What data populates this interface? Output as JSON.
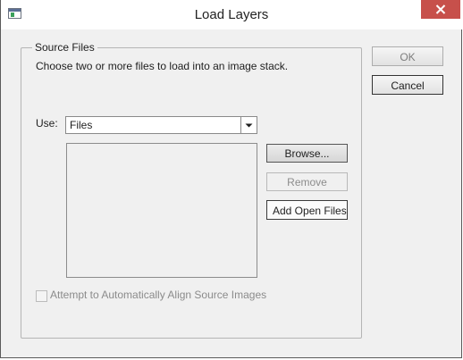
{
  "window": {
    "title": "Load Layers",
    "close_icon": "close-icon",
    "app_icon": "dialog-window-icon"
  },
  "group": {
    "legend": "Source Files",
    "description": "Choose two or more files to load into an image stack."
  },
  "use": {
    "label": "Use:",
    "selected": "Files",
    "dropdown_icon": "chevron-down-icon"
  },
  "file_list": {
    "items": []
  },
  "buttons": {
    "ok": "OK",
    "cancel": "Cancel",
    "browse": "Browse...",
    "remove": "Remove",
    "add_open_files": "Add Open Files"
  },
  "options": {
    "auto_align_label": "Attempt to Automatically Align Source Images",
    "auto_align_checked": false
  },
  "colors": {
    "close_button": "#c7504b",
    "dialog_background": "#f0f0f0"
  }
}
